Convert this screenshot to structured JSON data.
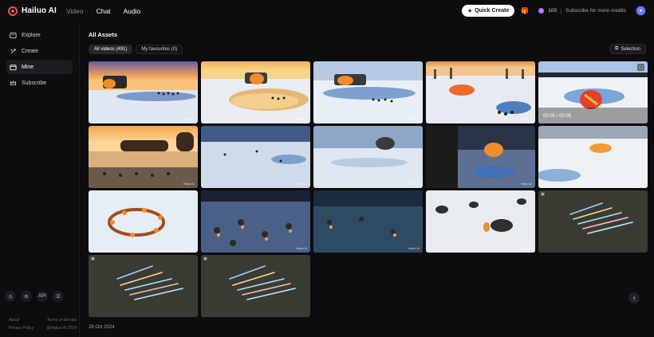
{
  "brand": {
    "name": "Hailuo AI"
  },
  "nav": [
    "Video",
    "Chat",
    "Audio"
  ],
  "topright": {
    "quick_create": "Quick Create",
    "credits": "100",
    "subscribe": "Subscribe for more credits"
  },
  "sidebar": {
    "items": [
      {
        "label": "Explore"
      },
      {
        "label": "Create"
      },
      {
        "label": "Mine"
      },
      {
        "label": "Subscribe"
      }
    ],
    "bottom_icons": [
      "discord-icon",
      "gear-icon",
      "api-label",
      "menu-icon"
    ],
    "api_label": "API",
    "links": {
      "about": "About",
      "terms": "Terms of Service",
      "privacy": "Privacy Policy",
      "copyright": "@Hailuo AI 2024"
    }
  },
  "main": {
    "title": "All Assets",
    "tabs": [
      {
        "label": "All videos",
        "count": "(491)"
      },
      {
        "label": "My favourites",
        "count": "(0)"
      }
    ],
    "selection": "Selection",
    "hover_time": "00:00 / 00:05",
    "watermark": "Hailuo AI",
    "date_label": "28 Oct 2024"
  },
  "colors": {
    "accent": "#f24a5c",
    "bg": "#0d0d0f"
  }
}
